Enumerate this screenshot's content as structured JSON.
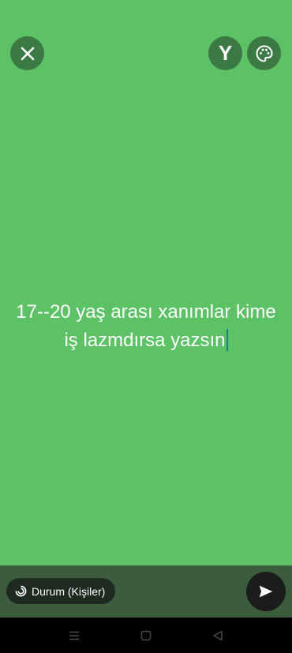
{
  "header": {
    "close_icon": "close-icon",
    "font_button_label": "Y",
    "palette_icon": "palette-icon"
  },
  "status": {
    "line1": "17--20 yaş arası xanımlar kime",
    "line2": "iş lazmdırsa yazsın"
  },
  "footer": {
    "audience_label": "Durum (Kişiler)",
    "audience_icon": "status-ring-icon",
    "send_icon": "send-icon"
  },
  "nav": {
    "menu_icon": "menu-icon",
    "home_icon": "home-icon",
    "back_icon": "back-icon"
  },
  "colors": {
    "background": "#5cc265",
    "button_bg": "#3b7a45",
    "footer_bg": "#3b5d3c",
    "cursor": "#1a7f88"
  }
}
